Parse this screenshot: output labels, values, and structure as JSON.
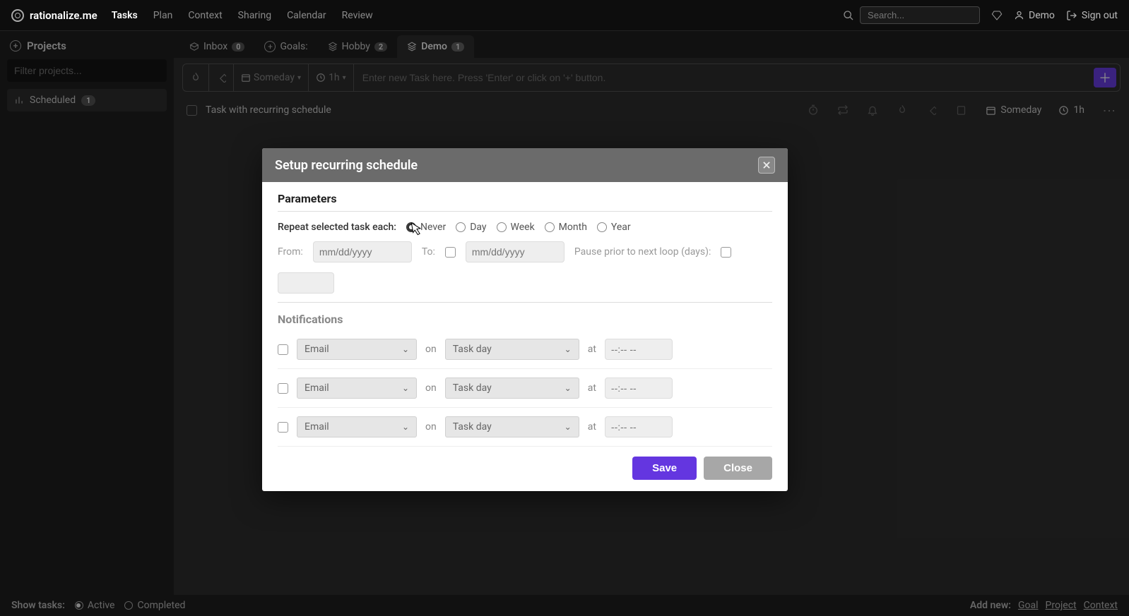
{
  "brand": "rationalize.me",
  "topnav": [
    "Tasks",
    "Plan",
    "Context",
    "Sharing",
    "Calendar",
    "Review"
  ],
  "topnav_active": 0,
  "search_placeholder": "Search...",
  "user_name": "Demo",
  "signout": "Sign out",
  "sidebar": {
    "header": "Projects",
    "filter_placeholder": "Filter projects...",
    "item_label": "Scheduled",
    "item_count": "1"
  },
  "tabs": [
    {
      "icon": "box",
      "label": "Inbox",
      "badge": "0"
    },
    {
      "icon": "plus",
      "label": "Goals:",
      "badge": ""
    },
    {
      "icon": "stack",
      "label": "Hobby",
      "badge": "2"
    },
    {
      "icon": "stack",
      "label": "Demo",
      "badge": "1"
    }
  ],
  "active_tab": 3,
  "task_input": {
    "someday": "Someday",
    "duration": "1h",
    "placeholder": "Enter new Task here. Press 'Enter' or click on '+' button."
  },
  "task": {
    "title": "Task with recurring schedule",
    "date": "Someday",
    "duration": "1h"
  },
  "footer": {
    "show_label": "Show tasks:",
    "active": "Active",
    "completed": "Completed",
    "add_new": "Add new:",
    "links": [
      "Goal",
      "Project",
      "Context"
    ]
  },
  "modal": {
    "title": "Setup recurring schedule",
    "section_params": "Parameters",
    "repeat_label": "Repeat selected task each:",
    "repeat_options": [
      "Never",
      "Day",
      "Week",
      "Month",
      "Year"
    ],
    "repeat_selected": 0,
    "from_label": "From:",
    "to_label": "To:",
    "date_placeholder": "mm/dd/yyyy",
    "pause_label": "Pause prior to next loop (days):",
    "section_notif": "Notifications",
    "notif_method": "Email",
    "on_label": "on",
    "notif_day": "Task day",
    "at_label": "at",
    "time_placeholder": "--:-- --",
    "save": "Save",
    "close": "Close"
  }
}
